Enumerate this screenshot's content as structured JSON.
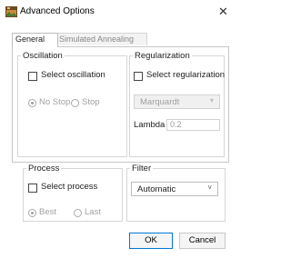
{
  "window": {
    "title": "Advanced Options",
    "close_glyph": "✕"
  },
  "tabs": [
    {
      "label": "General",
      "active": true
    },
    {
      "label": "Simulated Annealing",
      "active": false
    }
  ],
  "oscillation": {
    "legend": "Oscillation",
    "checkbox_label": "Select oscillation",
    "checked": false,
    "radios": [
      {
        "label": "No Stop",
        "selected": true
      },
      {
        "label": "Stop",
        "selected": false
      }
    ]
  },
  "regularization": {
    "legend": "Regularization",
    "checkbox_label": "Select regularization",
    "checked": false,
    "method_value": "Marquardt",
    "lambda_label": "Lambda",
    "lambda_value": "0.2"
  },
  "process": {
    "legend": "Process",
    "checkbox_label": "Select process",
    "checked": false,
    "radios": [
      {
        "label": "Best",
        "selected": true
      },
      {
        "label": "Last",
        "selected": false
      }
    ]
  },
  "filter": {
    "legend": "Filter",
    "value": "Automatic"
  },
  "buttons": {
    "ok": "OK",
    "cancel": "Cancel"
  }
}
